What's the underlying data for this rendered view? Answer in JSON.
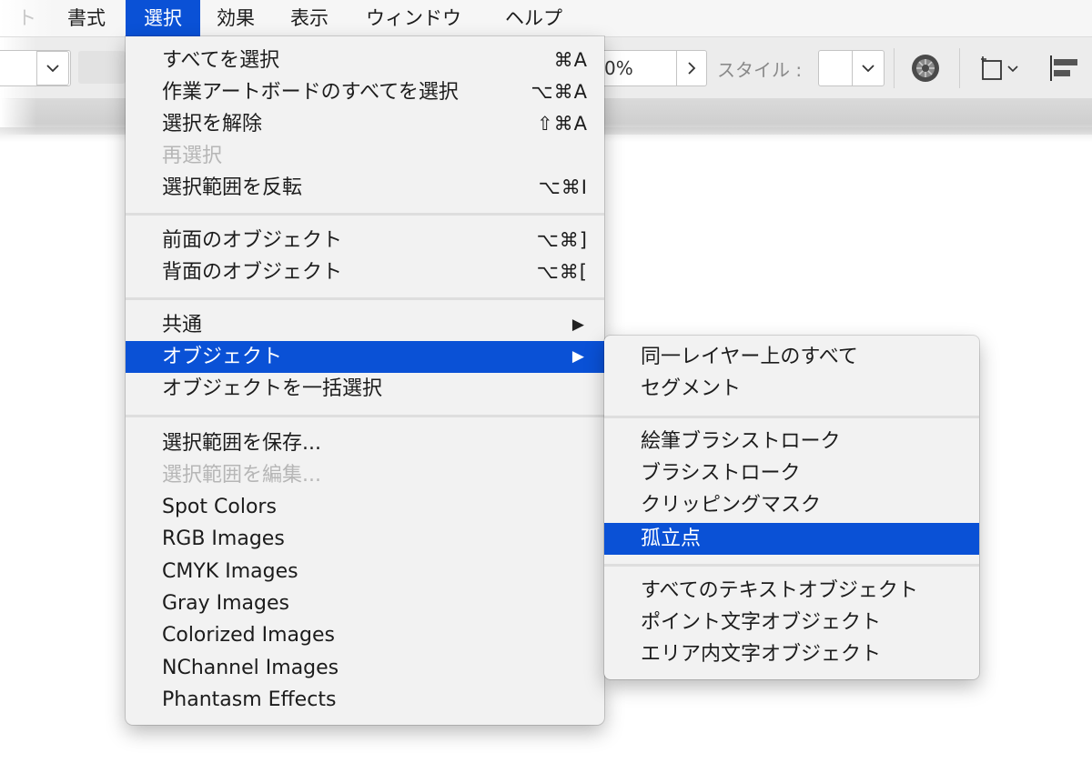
{
  "menubar": {
    "items": [
      {
        "label": "ト",
        "state": "faded"
      },
      {
        "label": "書式",
        "state": "normal"
      },
      {
        "label": "選択",
        "state": "active"
      },
      {
        "label": "効果",
        "state": "normal"
      },
      {
        "label": "表示",
        "state": "normal"
      },
      {
        "label": "ウィンドウ",
        "state": "normal"
      },
      {
        "label": "ヘルプ",
        "state": "normal"
      }
    ]
  },
  "toolbar": {
    "opacity_value": "0%",
    "style_label": "スタイル :",
    "icons": [
      "chevron-down-icon",
      "chevron-right-icon",
      "recolor-icon",
      "transform-icon",
      "align-icon"
    ]
  },
  "select_menu": {
    "items": [
      {
        "label": "すべてを選択",
        "shortcut": "⌘A"
      },
      {
        "label": "作業アートボードのすべてを選択",
        "shortcut": "⌥⌘A"
      },
      {
        "label": "選択を解除",
        "shortcut": "⇧⌘A"
      },
      {
        "label": "再選択",
        "shortcut": ""
      },
      {
        "label": "選択範囲を反転",
        "shortcut": "⌥⌘I"
      },
      {
        "label": "前面のオブジェクト",
        "shortcut": "⌥⌘]"
      },
      {
        "label": "背面のオブジェクト",
        "shortcut": "⌥⌘["
      },
      {
        "label": "共通",
        "shortcut": ""
      },
      {
        "label": "オブジェクト",
        "shortcut": ""
      },
      {
        "label": "オブジェクトを一括選択",
        "shortcut": ""
      },
      {
        "label": "選択範囲を保存...",
        "shortcut": ""
      },
      {
        "label": "選択範囲を編集...",
        "shortcut": ""
      },
      {
        "label": "Spot Colors",
        "shortcut": ""
      },
      {
        "label": "RGB Images",
        "shortcut": ""
      },
      {
        "label": "CMYK Images",
        "shortcut": ""
      },
      {
        "label": "Gray Images",
        "shortcut": ""
      },
      {
        "label": "Colorized Images",
        "shortcut": ""
      },
      {
        "label": "NChannel Images",
        "shortcut": ""
      },
      {
        "label": "Phantasm Effects",
        "shortcut": ""
      }
    ]
  },
  "object_submenu": {
    "items": [
      {
        "label": "同一レイヤー上のすべて"
      },
      {
        "label": "セグメント"
      },
      {
        "label": "絵筆ブラシストローク"
      },
      {
        "label": "ブラシストローク"
      },
      {
        "label": "クリッピングマスク"
      },
      {
        "label": "孤立点"
      },
      {
        "label": "すべてのテキストオブジェクト"
      },
      {
        "label": "ポイント文字オブジェクト"
      },
      {
        "label": "エリア内文字オブジェクト"
      }
    ]
  },
  "colors": {
    "highlight": "#0a51d6",
    "menu_bg": "#f2f2f2",
    "disabled_text": "#b6b6b6"
  }
}
